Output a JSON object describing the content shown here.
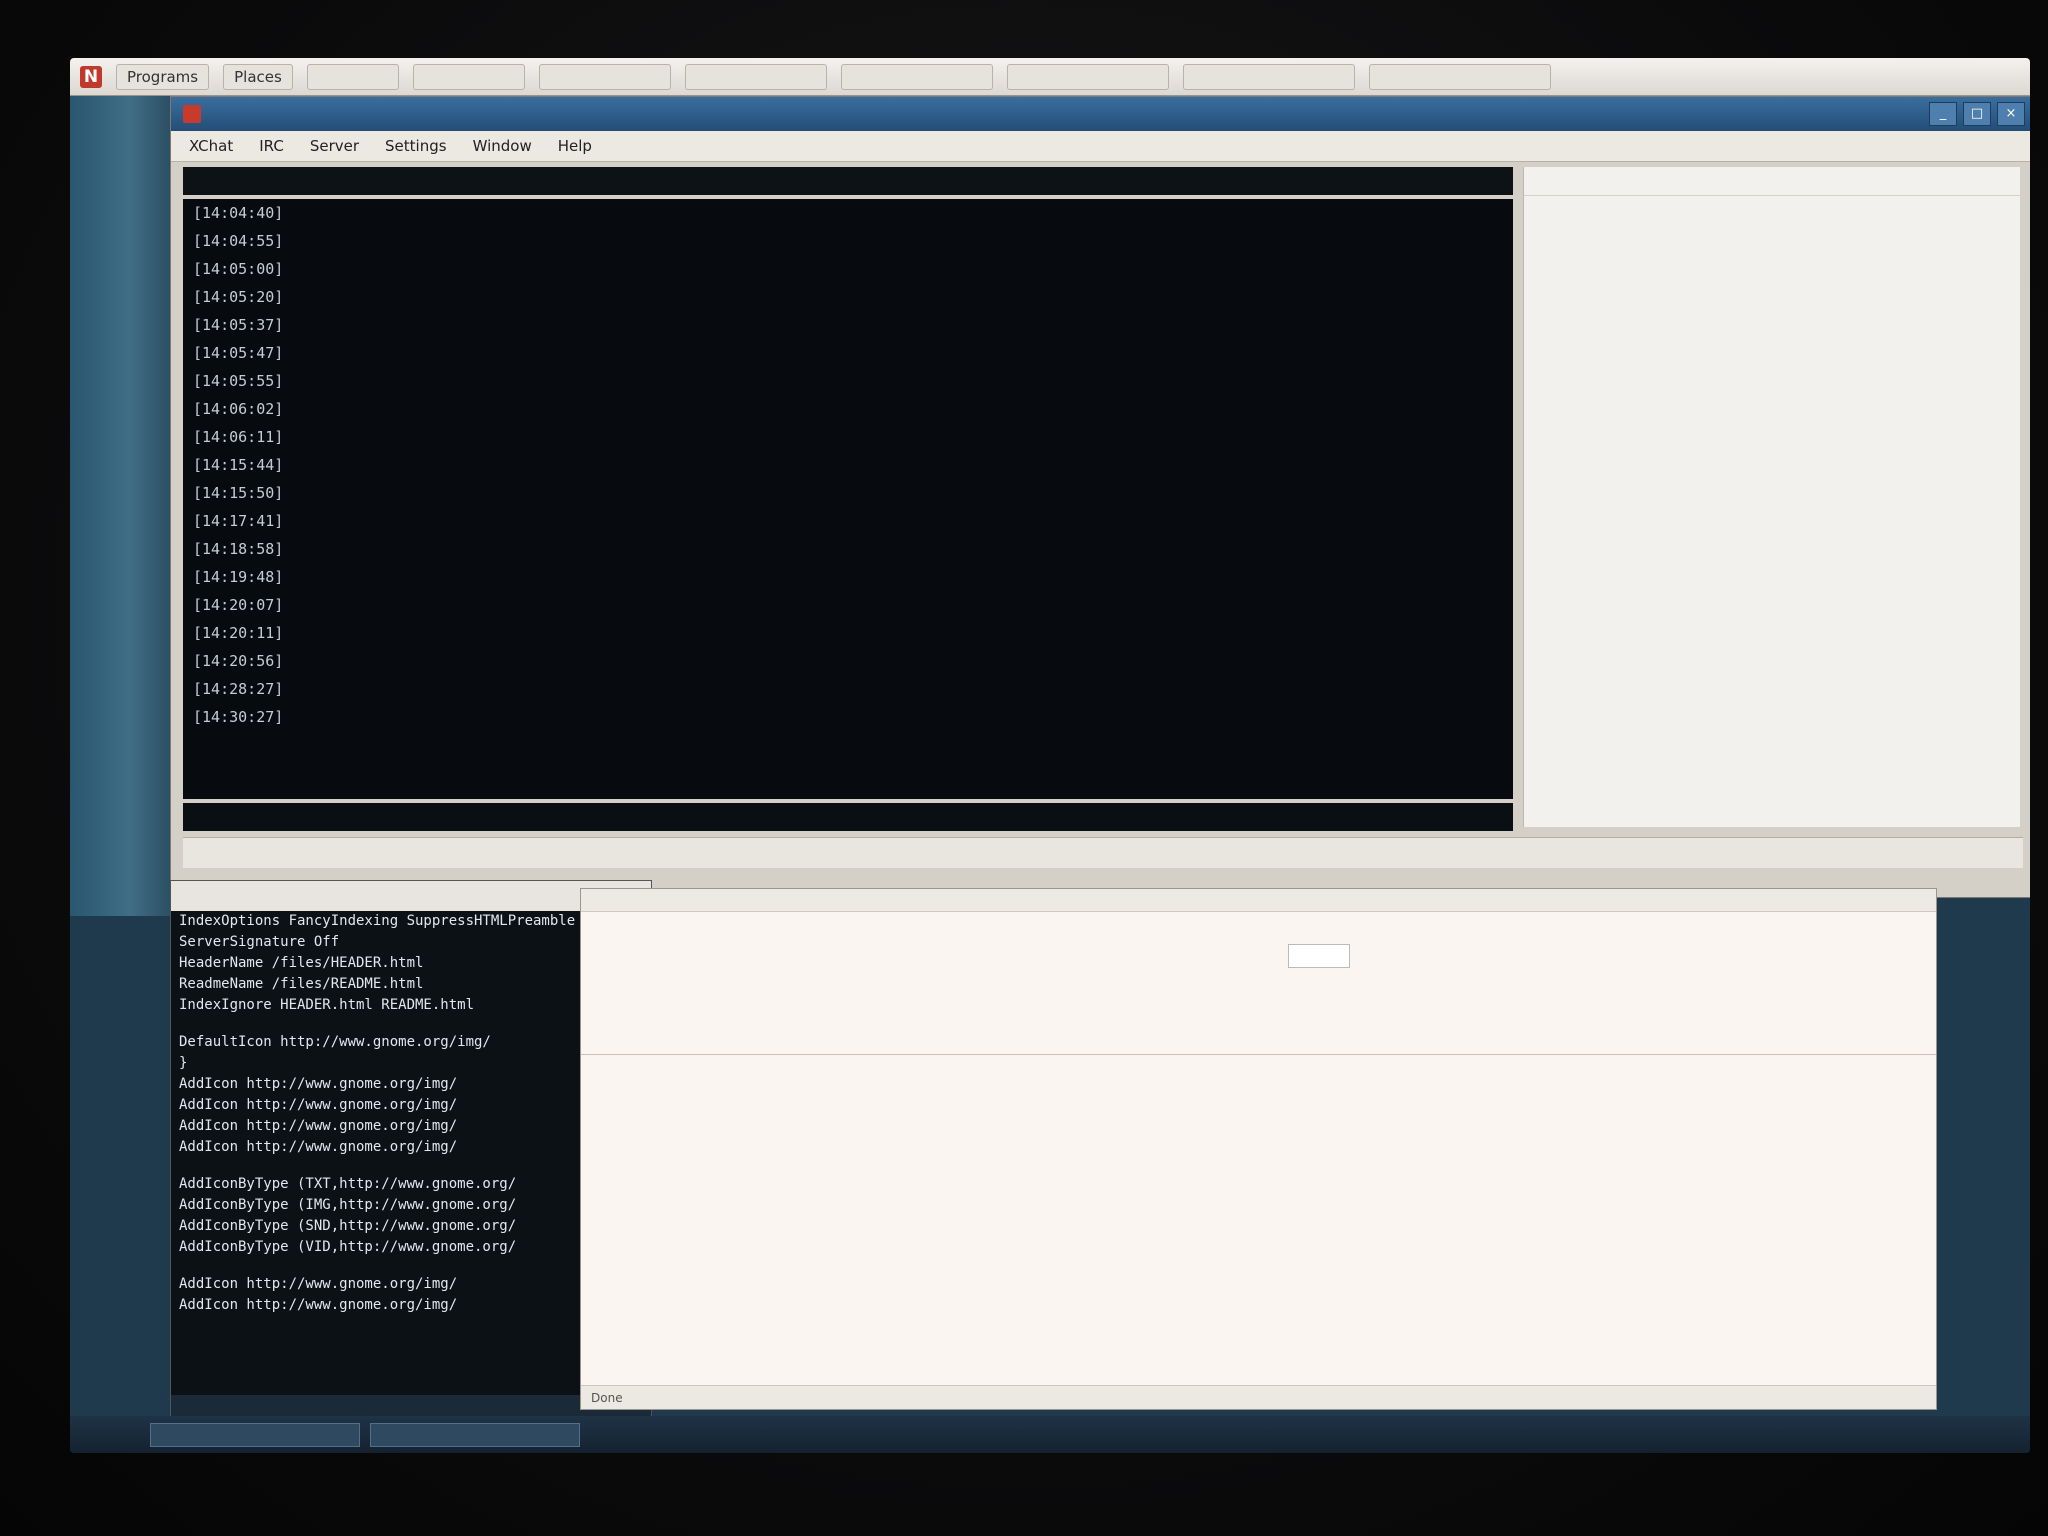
{
  "top_panel": {
    "launchers": [
      "Programs",
      "Places",
      "",
      "",
      "",
      "",
      "",
      "",
      "",
      ""
    ],
    "clock": ""
  },
  "main_window": {
    "title": "",
    "menu": [
      "XChat",
      "IRC",
      "Server",
      "Settings",
      "Window",
      "Help"
    ],
    "topic": "",
    "chat_lines": [
      {
        "ts": "[14:04:40]",
        "nick": "",
        "msg": ""
      },
      {
        "ts": "[14:04:55]",
        "nick": "",
        "msg": ""
      },
      {
        "ts": "[14:05:00]",
        "nick": "",
        "msg": ""
      },
      {
        "ts": "[14:05:20]",
        "nick": "",
        "msg": ""
      },
      {
        "ts": "[14:05:37]",
        "nick": "",
        "msg": ""
      },
      {
        "ts": "[14:05:47]",
        "nick": "",
        "msg": ""
      },
      {
        "ts": "[14:05:55]",
        "nick": "",
        "msg": ""
      },
      {
        "ts": "[14:06:02]",
        "nick": "",
        "msg": ""
      },
      {
        "ts": "[14:06:11]",
        "nick": "",
        "msg": ""
      },
      {
        "ts": "[14:15:44]",
        "nick": "",
        "msg": ""
      },
      {
        "ts": "[14:15:50]",
        "nick": "",
        "msg": ""
      },
      {
        "ts": "[14:17:41]",
        "nick": "",
        "msg": ""
      },
      {
        "ts": "[14:18:58]",
        "nick": "",
        "msg": ""
      },
      {
        "ts": "[14:19:48]",
        "nick": "",
        "msg": ""
      },
      {
        "ts": "[14:20:07]",
        "nick": "",
        "msg": ""
      },
      {
        "ts": "[14:20:11]",
        "nick": "",
        "msg": ""
      },
      {
        "ts": "[14:20:56]",
        "nick": "",
        "msg": ""
      },
      {
        "ts": "[14:28:27]",
        "nick": "",
        "msg": ""
      },
      {
        "ts": "[14:30:27]",
        "nick": "",
        "msg": ""
      }
    ],
    "input_label": "",
    "channel_tabs": [
      "",
      "",
      "",
      "",
      "",
      "",
      "",
      "",
      "",
      "",
      "",
      ""
    ],
    "userlist_header": "",
    "userlist": [
      "",
      "",
      "",
      "",
      "",
      "",
      "",
      "",
      "",
      "",
      "",
      "",
      "",
      "",
      "",
      "",
      "",
      "",
      "",
      "",
      ""
    ]
  },
  "editor_window": {
    "title": "",
    "title_right": "",
    "lines": [
      "IndexOptions FancyIndexing SuppressHTMLPreamble",
      "ServerSignature Off",
      "HeaderName /files/HEADER.html",
      "ReadmeName /files/README.html",
      "IndexIgnore HEADER.html README.html",
      "",
      "DefaultIcon http://www.gnome.org/img/",
      "}",
      "AddIcon http://www.gnome.org/img/",
      "AddIcon http://www.gnome.org/img/",
      "AddIcon http://www.gnome.org/img/",
      "AddIcon http://www.gnome.org/img/",
      "",
      "AddIconByType (TXT,http://www.gnome.org/",
      "AddIconByType (IMG,http://www.gnome.org/",
      "AddIconByType (SND,http://www.gnome.org/",
      "AddIconByType (VID,http://www.gnome.org/",
      "",
      "AddIcon http://www.gnome.org/img/",
      "AddIcon http://www.gnome.org/img/"
    ],
    "status": ""
  },
  "browser_window": {
    "header_text": "",
    "search_button": "",
    "nav_links": "",
    "footer_links": "",
    "copyright": "",
    "status": "Done"
  },
  "taskbar": {
    "buttons": [
      "",
      ""
    ]
  }
}
